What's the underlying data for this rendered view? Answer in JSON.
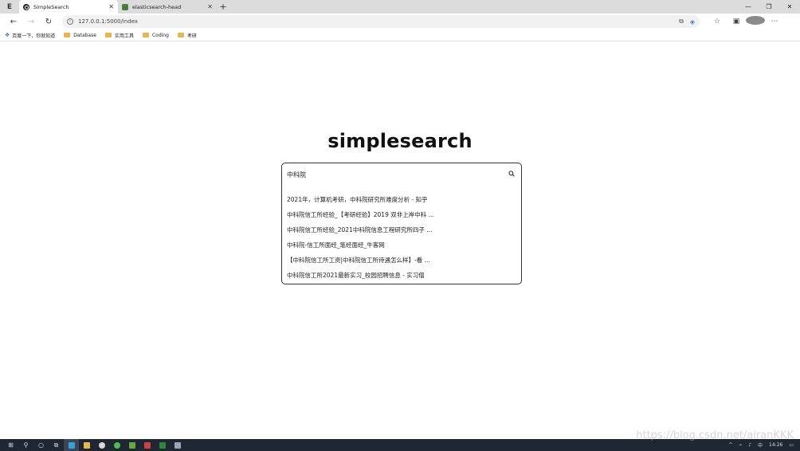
{
  "browser": {
    "tabs": [
      {
        "label": "SimpleSearch",
        "active": true
      },
      {
        "label": "elasticsearch-head",
        "active": false
      }
    ],
    "address": {
      "url": "127.0.0.1:5000/index"
    },
    "bookmarks": [
      {
        "label": "百度一下，你就知道",
        "icon": "star-icon"
      },
      {
        "label": "Database",
        "icon": "folder-icon"
      },
      {
        "label": "实用工具",
        "icon": "folder-icon"
      },
      {
        "label": "Coding",
        "icon": "folder-icon"
      },
      {
        "label": "考研",
        "icon": "folder-icon"
      }
    ]
  },
  "page": {
    "logo": "simplesearch",
    "search": {
      "value": "中科院"
    },
    "suggestions": [
      "2021年，计算机考研，中科院研究所难度分析 - 知乎",
      "中科院信工所经验_【考研经验】2019 双非上岸中科 ...",
      "中科院信工所经验_2021中科院信息工程研究所四子 ...",
      "中科院-信工所面经_笔经面经_牛客网",
      "【中科院信工所工资|中科院信工所待遇怎么样】-看 ...",
      "中科院信工所2021最新实习_校园招聘信息 - 实习僧"
    ]
  },
  "taskbar": {
    "time": "14:26"
  },
  "watermark": "https://blog.csdn.net/airanKKK",
  "colors": {
    "accent": "#3a7bd5",
    "taskbar": "#1f2733",
    "folder": "#e8b64a"
  }
}
